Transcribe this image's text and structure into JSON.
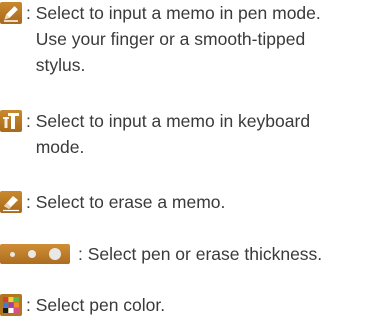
{
  "items": [
    {
      "icon": "pen-icon",
      "colon": ": ",
      "lines": [
        "Select to input a memo in pen mode.",
        "Use your finger or a smooth-tipped",
        "stylus."
      ]
    },
    {
      "icon": "keyboard-text-icon",
      "colon": ": ",
      "lines": [
        "Select to input a memo in keyboard",
        "mode."
      ]
    },
    {
      "icon": "eraser-icon",
      "colon": ": ",
      "lines": [
        "Select to erase a memo."
      ]
    },
    {
      "icon": "thickness-icon",
      "colon": ": ",
      "lines": [
        "Select pen or erase thickness."
      ]
    },
    {
      "icon": "color-palette-icon",
      "colon": ": ",
      "lines": [
        "Select pen color."
      ]
    }
  ],
  "colors": {
    "icon_bg": "#b97a26",
    "text": "#3a3a3a"
  }
}
